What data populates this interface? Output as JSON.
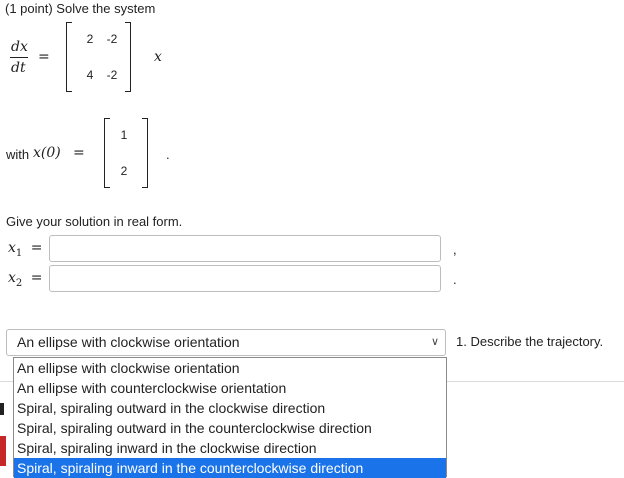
{
  "problem": {
    "intro": "(1 point) Solve the system",
    "lhs_num": "dx",
    "lhs_den": "dt",
    "eq": "=",
    "matrix": [
      [
        "2",
        "-2"
      ],
      [
        "4",
        "-2"
      ]
    ],
    "var": "x",
    "with_text": "with",
    "initial_lhs": "x(0)",
    "initial_eq": "=",
    "initial_vec": [
      "1",
      "2"
    ],
    "period": ".",
    "instruction": "Give your solution in real form."
  },
  "answers": [
    {
      "label": "x",
      "sub": "1",
      "eq": "=",
      "value": "",
      "suffix": ","
    },
    {
      "label": "x",
      "sub": "2",
      "eq": "=",
      "value": "",
      "suffix": "."
    }
  ],
  "trajectory": {
    "selected": "An ellipse with clockwise orientation",
    "prompt": "1. Describe the trajectory.",
    "options": [
      "An ellipse with clockwise orientation",
      "An ellipse with counterclockwise orientation",
      "Spiral, spiraling outward in the clockwise direction",
      "Spiral, spiraling outward in the counterclockwise direction",
      "Spiral, spiraling inward in the clockwise direction",
      "Spiral, spiraling inward in the counterclockwise direction"
    ],
    "highlighted_index": 5
  },
  "colors": {
    "highlight": "#1a73e8",
    "border": "#bdbdbd"
  }
}
